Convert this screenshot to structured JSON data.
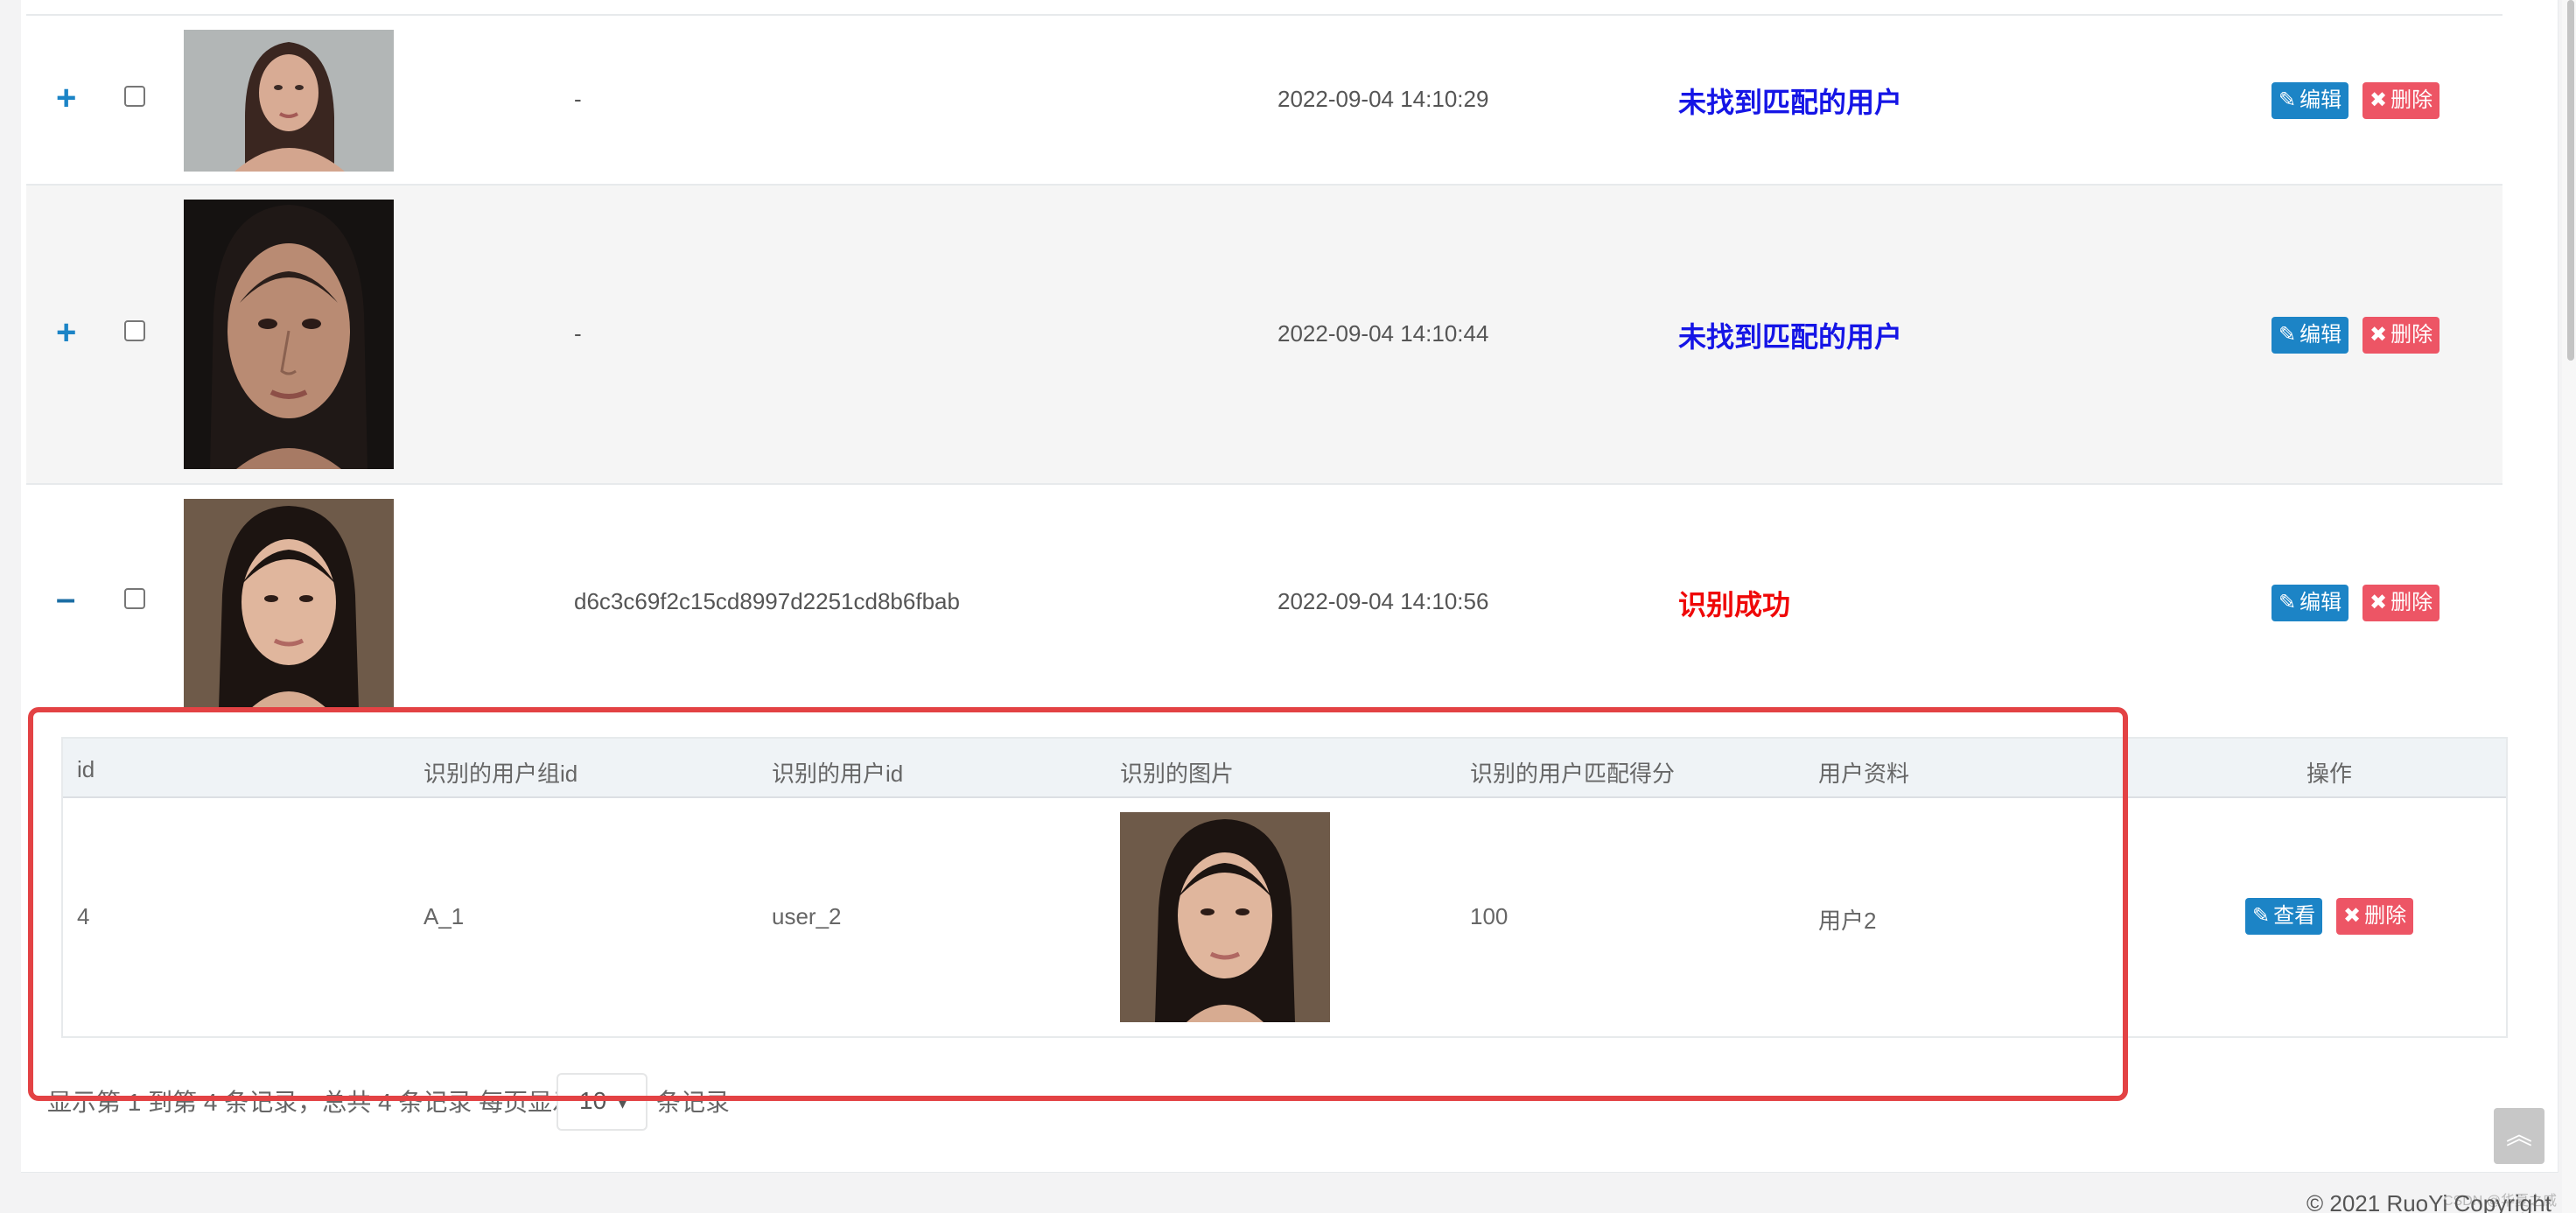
{
  "rows": [
    {
      "expander": "+",
      "user_id": "-",
      "time": "2022-09-04 14:10:29",
      "status": "未找到匹配的用户",
      "edit_label": "编辑",
      "delete_label": "删除"
    },
    {
      "expander": "+",
      "user_id": "-",
      "time": "2022-09-04 14:10:44",
      "status": "未找到匹配的用户",
      "edit_label": "编辑",
      "delete_label": "删除"
    },
    {
      "expander": "–",
      "user_id": "d6c3c69f2c15cd8997d2251cd8b6fbab",
      "time": "2022-09-04 14:10:56",
      "status": "识别成功",
      "edit_label": "编辑",
      "delete_label": "删除"
    }
  ],
  "detail": {
    "headers": [
      "id",
      "识别的用户组id",
      "识别的用户id",
      "识别的图片",
      "识别的用户匹配得分",
      "用户资料",
      "操作"
    ],
    "row": {
      "id": "4",
      "group_id": "A_1",
      "user_id": "user_2",
      "score": "100",
      "profile": "用户2",
      "view_label": "查看",
      "delete_label": "删除"
    }
  },
  "pagination": {
    "summary": "显示第 1 到第 4 条记录，总共 4 条记录  每页显示",
    "page_size": "10",
    "suffix": "条记录"
  },
  "watermark": "CSDN @华夏之威",
  "footer": "© 2021 RuoYi Copyright",
  "colors": {
    "status_not_found": "#1515e6",
    "status_success": "#ef0808",
    "edit_button": "#1c84c6",
    "delete_button": "#ed5565",
    "highlight_box": "#e34244"
  }
}
